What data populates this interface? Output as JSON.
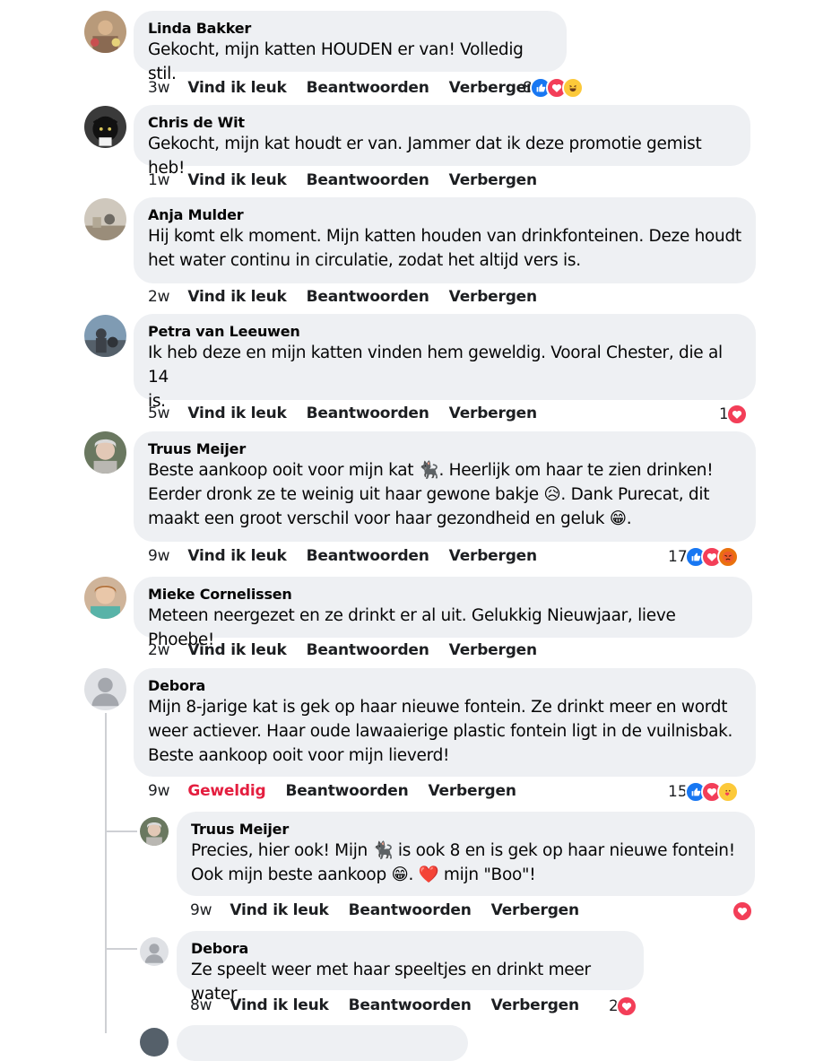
{
  "comments": [
    {
      "name": "Linda Bakker",
      "text": "Gekocht, mijn katten HOUDEN er van! Volledig stil.",
      "time": "3w",
      "like": "Vind ik leuk",
      "reply": "Beantwoorden",
      "hide": "Verbergen",
      "reaction_count": "8",
      "reactions": [
        "like-icon",
        "love-icon",
        "haha-icon"
      ]
    },
    {
      "name": "Chris de Wit",
      "text": "Gekocht, mijn kat houdt er van. Jammer dat ik deze promotie gemist heb!",
      "time": "1w",
      "like": "Vind ik leuk",
      "reply": "Beantwoorden",
      "hide": "Verbergen"
    },
    {
      "name": "Anja Mulder",
      "text_line1": "Hij komt elk moment. Mijn katten houden van drinkfonteinen. Deze houdt",
      "text_line2": "het water continu in circulatie, zodat het altijd vers is.",
      "time": "2w",
      "like": "Vind ik leuk",
      "reply": "Beantwoorden",
      "hide": "Verbergen"
    },
    {
      "name": "Petra van Leeuwen",
      "text_line1": "Ik heb deze en mijn katten vinden hem geweldig. Vooral Chester, die al 14",
      "text_line2": "is.",
      "time": "5w",
      "like": "Vind ik leuk",
      "reply": "Beantwoorden",
      "hide": "Verbergen",
      "reaction_count": "1",
      "reactions": [
        "love-icon"
      ]
    },
    {
      "name": "Truus Meijer",
      "text_line1": "Beste aankoop ooit voor mijn kat 🐈‍⬛. Heerlijk om haar te zien drinken!",
      "text_line2": "Eerder dronk ze te weinig uit haar gewone bakje 😥. Dank Purecat, dit",
      "text_line3": "maakt een groot verschil voor haar gezondheid en geluk 😁.",
      "time": "9w",
      "like": "Vind ik leuk",
      "reply": "Beantwoorden",
      "hide": "Verbergen",
      "reaction_count": "17",
      "reactions": [
        "like-icon",
        "love-icon",
        "angry-icon"
      ]
    },
    {
      "name": "Mieke Cornelissen",
      "text": "Meteen neergezet en ze drinkt er al uit. Gelukkig Nieuwjaar, lieve Phoebe!",
      "time": "2w",
      "like": "Vind ik leuk",
      "reply": "Beantwoorden",
      "hide": "Verbergen"
    },
    {
      "name": "Debora",
      "text_line1": "Mijn 8-jarige kat is gek op haar nieuwe fontein. Ze drinkt meer en wordt",
      "text_line2": "weer actiever. Haar oude lawaaierige plastic fontein ligt in de vuilnisbak.",
      "text_line3": "Beste aankoop ooit voor mijn lieverd!",
      "time": "9w",
      "like": "Geweldig",
      "reply": "Beantwoorden",
      "hide": "Verbergen",
      "reaction_count": "15",
      "reactions": [
        "like-icon",
        "love-icon",
        "care-icon"
      ]
    }
  ],
  "replies": [
    {
      "name": "Truus Meijer",
      "text_line1": "Precies, hier ook! Mijn 🐈‍⬛ is ook 8 en is gek op haar nieuwe fontein!",
      "text_line2": "Ook mijn beste aankoop 😁. ❤️ mijn \"Boo\"!",
      "time": "9w",
      "like": "Vind ik leuk",
      "reply": "Beantwoorden",
      "hide": "Verbergen",
      "reactions": [
        "love-icon"
      ]
    },
    {
      "name": "Debora",
      "text": "Ze speelt weer met haar speeltjes en drinkt meer water",
      "time": "8w",
      "like": "Vind ik leuk",
      "reply": "Beantwoorden",
      "hide": "Verbergen",
      "reaction_count": "2",
      "reactions": [
        "love-icon"
      ]
    }
  ],
  "colors": {
    "bubble": "#eef0f3",
    "like": "#1877f2",
    "love": "#f33e58",
    "liked_text": "#e41e3f"
  }
}
